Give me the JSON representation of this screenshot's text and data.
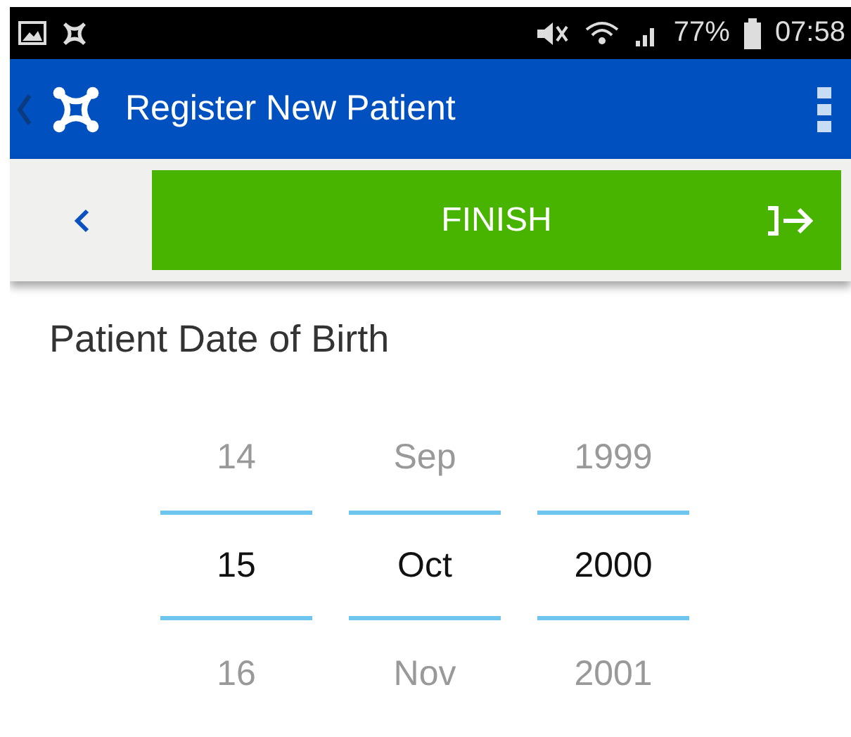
{
  "status_bar": {
    "battery": "77%",
    "time": "07:58"
  },
  "app_bar": {
    "title": "Register New Patient"
  },
  "toolbar": {
    "finish_label": "FINISH"
  },
  "date_picker": {
    "label": "Patient Date of Birth",
    "columns": [
      {
        "values": [
          {
            "text": "14",
            "selected": false
          },
          {
            "text": "15",
            "selected": true
          },
          {
            "text": "16",
            "selected": false
          }
        ]
      },
      {
        "values": [
          {
            "text": "Sep",
            "selected": false
          },
          {
            "text": "Oct",
            "selected": true
          },
          {
            "text": "Nov",
            "selected": false
          }
        ]
      },
      {
        "values": [
          {
            "text": "1999",
            "selected": false
          },
          {
            "text": "2000",
            "selected": true
          },
          {
            "text": "2001",
            "selected": false
          }
        ]
      }
    ]
  }
}
